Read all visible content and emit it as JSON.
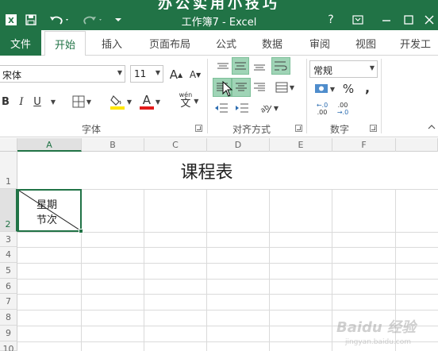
{
  "banner": "办公实用小技巧",
  "titlebar": {
    "title": "工作簿7 - Excel",
    "help": "?",
    "controls": [
      "restore-icon",
      "minimize-icon",
      "maximize-icon",
      "close-icon"
    ]
  },
  "tabs": {
    "file": "文件",
    "items": [
      "开始",
      "插入",
      "页面布局",
      "公式",
      "数据",
      "审阅",
      "视图",
      "开发工"
    ],
    "active": "开始"
  },
  "ribbon": {
    "font_name": "宋体",
    "font_size": "11",
    "grow_font": "A",
    "shrink_font": "A",
    "bold": "B",
    "italic": "I",
    "underline": "U",
    "font_color": "A",
    "phonetic": "文",
    "groups": {
      "font": "字体",
      "alignment": "对齐方式",
      "number": "数字"
    },
    "number_format": "常规",
    "percent": "%",
    "comma": ",",
    "inc_decimal": ".00",
    "dec_decimal": ".00"
  },
  "sheet": {
    "columns": [
      "A",
      "B",
      "C",
      "D",
      "E",
      "F"
    ],
    "rows": [
      "1",
      "2",
      "3",
      "4",
      "5",
      "6",
      "7",
      "8",
      "9",
      "10"
    ],
    "title": "课程表",
    "diag_top": "星期",
    "diag_bottom": "节次"
  },
  "watermark": "Baidu 经验",
  "watermark_sub": "jingyan.baidu.com"
}
